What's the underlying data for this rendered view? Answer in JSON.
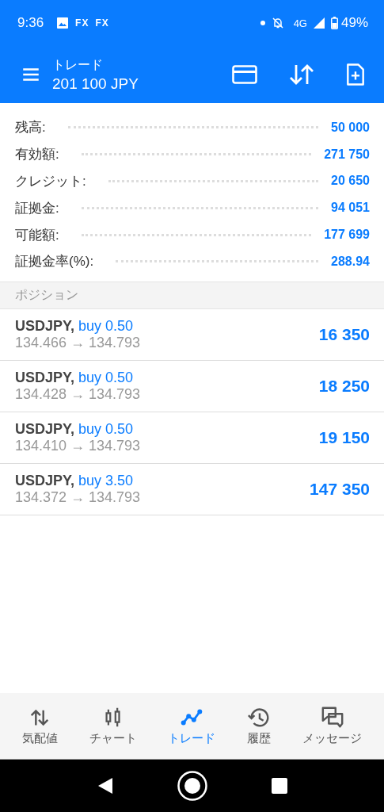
{
  "status_bar": {
    "time": "9:36",
    "notifications": [
      "FX",
      "FX"
    ],
    "network": "4G",
    "battery": "49%"
  },
  "app_bar": {
    "title": "トレード",
    "subtitle": "201 100 JPY"
  },
  "summary": [
    {
      "label": "残高:",
      "value": "50 000"
    },
    {
      "label": "有効額:",
      "value": "271 750"
    },
    {
      "label": "クレジット:",
      "value": "20 650"
    },
    {
      "label": "証拠金:",
      "value": "94 051"
    },
    {
      "label": "可能額:",
      "value": "177 699"
    },
    {
      "label": "証拠金率(%):",
      "value": "288.94"
    }
  ],
  "section": "ポジション",
  "positions": [
    {
      "symbol": "USDJPY,",
      "order": "buy 0.50",
      "prices": "134.466 → 134.793",
      "profit": "16 350"
    },
    {
      "symbol": "USDJPY,",
      "order": "buy 0.50",
      "prices": "134.428 → 134.793",
      "profit": "18 250"
    },
    {
      "symbol": "USDJPY,",
      "order": "buy 0.50",
      "prices": "134.410 → 134.793",
      "profit": "19 150"
    },
    {
      "symbol": "USDJPY,",
      "order": "buy 3.50",
      "prices": "134.372 → 134.793",
      "profit": "147 350"
    }
  ],
  "bottom_nav": [
    {
      "kind": "quotes",
      "label": "気配値",
      "selected": false
    },
    {
      "kind": "chart",
      "label": "チャート",
      "selected": false
    },
    {
      "kind": "trade",
      "label": "トレード",
      "selected": true
    },
    {
      "kind": "history",
      "label": "履歴",
      "selected": false
    },
    {
      "kind": "messages",
      "label": "メッセージ",
      "selected": false
    }
  ]
}
